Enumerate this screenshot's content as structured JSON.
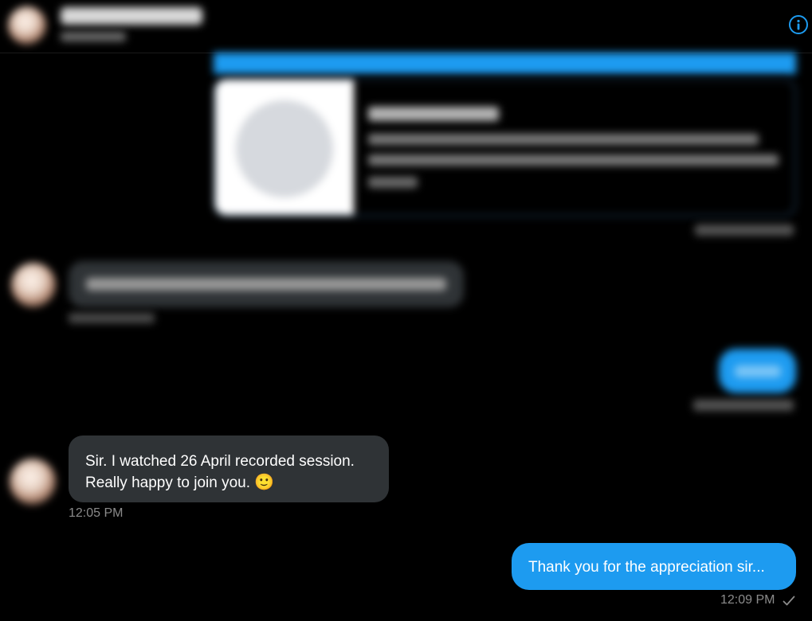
{
  "header": {
    "info_icon": "info-icon"
  },
  "messages": {
    "received_latest": {
      "text_line1": "Sir. I watched 26 April recorded session.",
      "text_line2": "Really happy to join you.",
      "emoji": "🙂",
      "time": "12:05 PM"
    },
    "sent_latest": {
      "text": "Thank you for the appreciation sir...",
      "time": "12:09 PM",
      "status_icon": "check-icon"
    }
  },
  "colors": {
    "background": "#000000",
    "accent": "#1d9bf0",
    "received_bubble": "#2f3336",
    "timestamp": "#8b8b8b"
  }
}
